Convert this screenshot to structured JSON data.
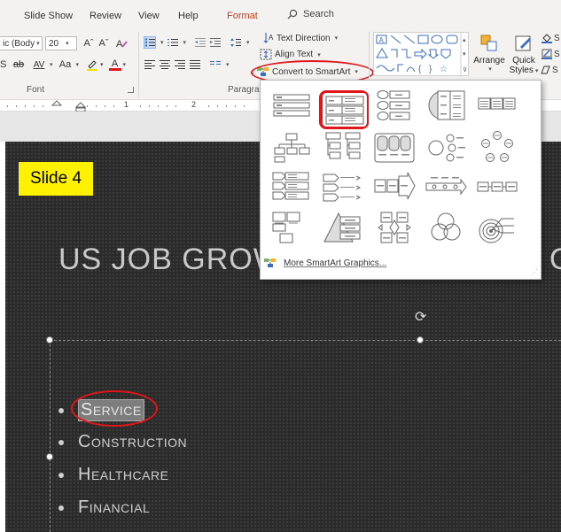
{
  "tabs": [
    {
      "label": "Slide Show"
    },
    {
      "label": "Review"
    },
    {
      "label": "View"
    },
    {
      "label": "Help"
    },
    {
      "label": "Format"
    }
  ],
  "search": {
    "label": "Search"
  },
  "font_group": {
    "font_name": "ic (Body",
    "font_size": "20",
    "label": "Font",
    "grow_label": "Aˆ",
    "shrink_label": "Aˇ",
    "spacing_label": "AV",
    "case_label": "Aa",
    "strike_label": "ab",
    "shadow_label": "S",
    "color_label": "A"
  },
  "paragraph_group": {
    "label": "Paragrap",
    "text_direction": "Text Direction",
    "align_text": "Align Text",
    "convert_smartart": "Convert to SmartArt"
  },
  "drawing_group": {
    "arrange": "Arrange",
    "quick_styles_line1": "Quick",
    "quick_styles_line2": "Styles",
    "shape_fill_letter": "S",
    "shape_outline_letter": "S",
    "shape_effects_letter": "S"
  },
  "ruler": {
    "marks": [
      "1",
      "2"
    ]
  },
  "slide": {
    "tag": "Slide 4",
    "title": "US JOB GROW",
    "title_tail": "OR",
    "bullets": [
      "Service",
      "Construction",
      "Healthcare",
      "Financial"
    ]
  },
  "smartart": {
    "more_label": "More SmartArt Graphics...",
    "layouts": [
      "basic-block-list",
      "vertical-bullet-list",
      "vertical-box-list",
      "horizontal-bullet-list",
      "lined-list",
      "organization-chart",
      "hierarchy-list",
      "picture-accent-list",
      "radial-list",
      "cycle",
      "stacked-list",
      "process-arrows",
      "accent-process",
      "basic-timeline",
      "basic-chevron",
      "picture-caption-list",
      "pyramid-list",
      "balance",
      "venn",
      "target"
    ]
  },
  "colors": {
    "accent_red": "#e0161b",
    "format_tab": "#c43e1c",
    "slide_tag_fill": "#fef200",
    "slide_background": "#2b2b2b"
  }
}
